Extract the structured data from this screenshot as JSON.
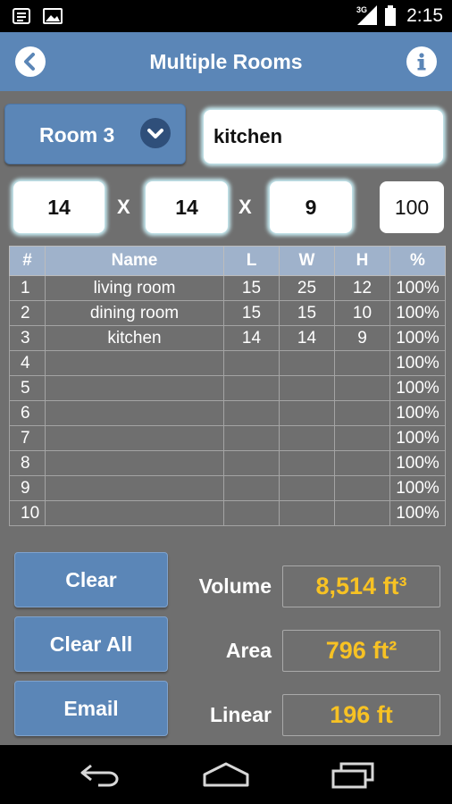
{
  "status": {
    "time": "2:15",
    "network": "3G"
  },
  "appbar": {
    "title": "Multiple Rooms",
    "back_icon": "back-chevron-icon",
    "info_icon": "info-icon"
  },
  "room": {
    "selector_label": "Room 3",
    "name_value": "kitchen",
    "length": "14",
    "width": "14",
    "height": "9",
    "percent": "100",
    "x_sep": "X"
  },
  "table": {
    "headers": [
      "#",
      "Name",
      "L",
      "W",
      "H",
      "%"
    ],
    "rows": [
      [
        "1",
        "living room",
        "15",
        "25",
        "12",
        "100%"
      ],
      [
        "2",
        "dining room",
        "15",
        "15",
        "10",
        "100%"
      ],
      [
        "3",
        "kitchen",
        "14",
        "14",
        "9",
        "100%"
      ],
      [
        "4",
        "",
        "",
        "",
        "",
        "100%"
      ],
      [
        "5",
        "",
        "",
        "",
        "",
        "100%"
      ],
      [
        "6",
        "",
        "",
        "",
        "",
        "100%"
      ],
      [
        "7",
        "",
        "",
        "",
        "",
        "100%"
      ],
      [
        "8",
        "",
        "",
        "",
        "",
        "100%"
      ],
      [
        "9",
        "",
        "",
        "",
        "",
        "100%"
      ],
      [
        "10",
        "",
        "",
        "",
        "",
        "100%"
      ]
    ]
  },
  "actions": {
    "clear": "Clear",
    "clear_all": "Clear All",
    "email": "Email"
  },
  "results": {
    "volume_label": "Volume",
    "volume_value": "8,514 ft³",
    "area_label": "Area",
    "area_value": "796 ft²",
    "linear_label": "Linear",
    "linear_value": "196 ft"
  },
  "colors": {
    "accent": "#5b86b7",
    "result": "#f7c224",
    "background": "#6f6f6f"
  }
}
